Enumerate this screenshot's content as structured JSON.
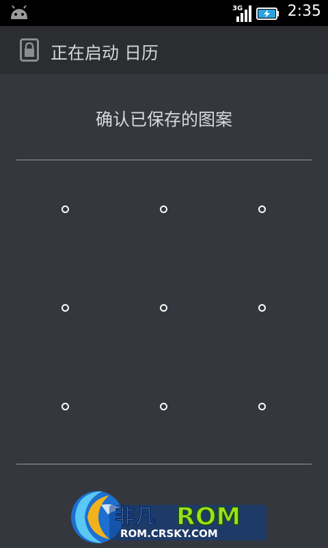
{
  "status_bar": {
    "network": "3G",
    "time": "2:35"
  },
  "title_bar": {
    "title": "正在启动 日历"
  },
  "main": {
    "heading": "确认已保存的图案"
  },
  "watermark": {
    "brand": "非凡",
    "product": "ROM",
    "url": "ROM.CRSKY.COM"
  },
  "colors": {
    "background": "#34373d",
    "titlebar": "#2b2d31",
    "statusbar": "#000000"
  }
}
